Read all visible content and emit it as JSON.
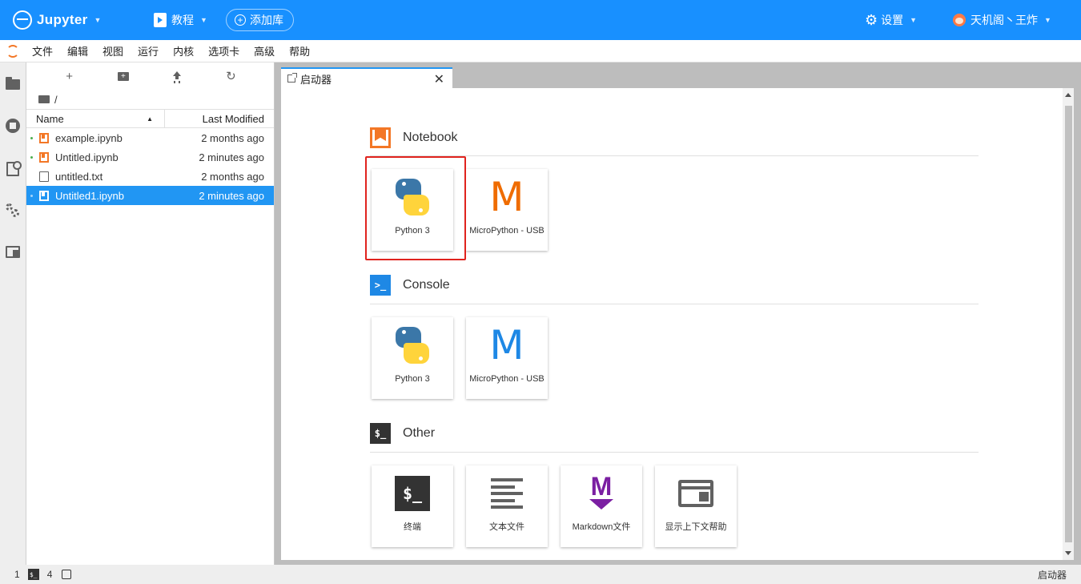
{
  "topbar": {
    "app_name": "Jupyter",
    "tutorial_label": "教程",
    "add_library_label": "添加库",
    "settings_label": "设置",
    "user_name": "天机阁丶王炸",
    "bar_color": "#1890ff"
  },
  "menubar": {
    "items": [
      "文件",
      "编辑",
      "视图",
      "运行",
      "内核",
      "选项卡",
      "高级",
      "帮助"
    ]
  },
  "filebrowser": {
    "breadcrumb": "/",
    "col_name": "Name",
    "col_modified": "Last Modified",
    "files": [
      {
        "name": "example.ipynb",
        "modified": "2 months ago",
        "type": "notebook",
        "running": true,
        "selected": false
      },
      {
        "name": "Untitled.ipynb",
        "modified": "2 minutes ago",
        "type": "notebook",
        "running": true,
        "selected": false
      },
      {
        "name": "untitled.txt",
        "modified": "2 months ago",
        "type": "text",
        "running": false,
        "selected": false
      },
      {
        "name": "Untitled1.ipynb",
        "modified": "2 minutes ago",
        "type": "notebook",
        "running": true,
        "selected": true
      }
    ]
  },
  "tab": {
    "label": "启动器"
  },
  "launcher": {
    "notebook": {
      "title": "Notebook",
      "cards": [
        "Python 3",
        "MicroPython - USB"
      ]
    },
    "console": {
      "title": "Console",
      "cards": [
        "Python 3",
        "MicroPython - USB"
      ]
    },
    "other": {
      "title": "Other",
      "cards": [
        "终端",
        "文本文件",
        "Markdown文件",
        "显示上下文帮助"
      ]
    }
  },
  "statusbar": {
    "terminal_count": "1",
    "kernel_count": "4",
    "right_label": "启动器"
  },
  "icons": {
    "terminal_glyph": "$_",
    "console_glyph": ">_",
    "micropython_glyph": "M"
  }
}
